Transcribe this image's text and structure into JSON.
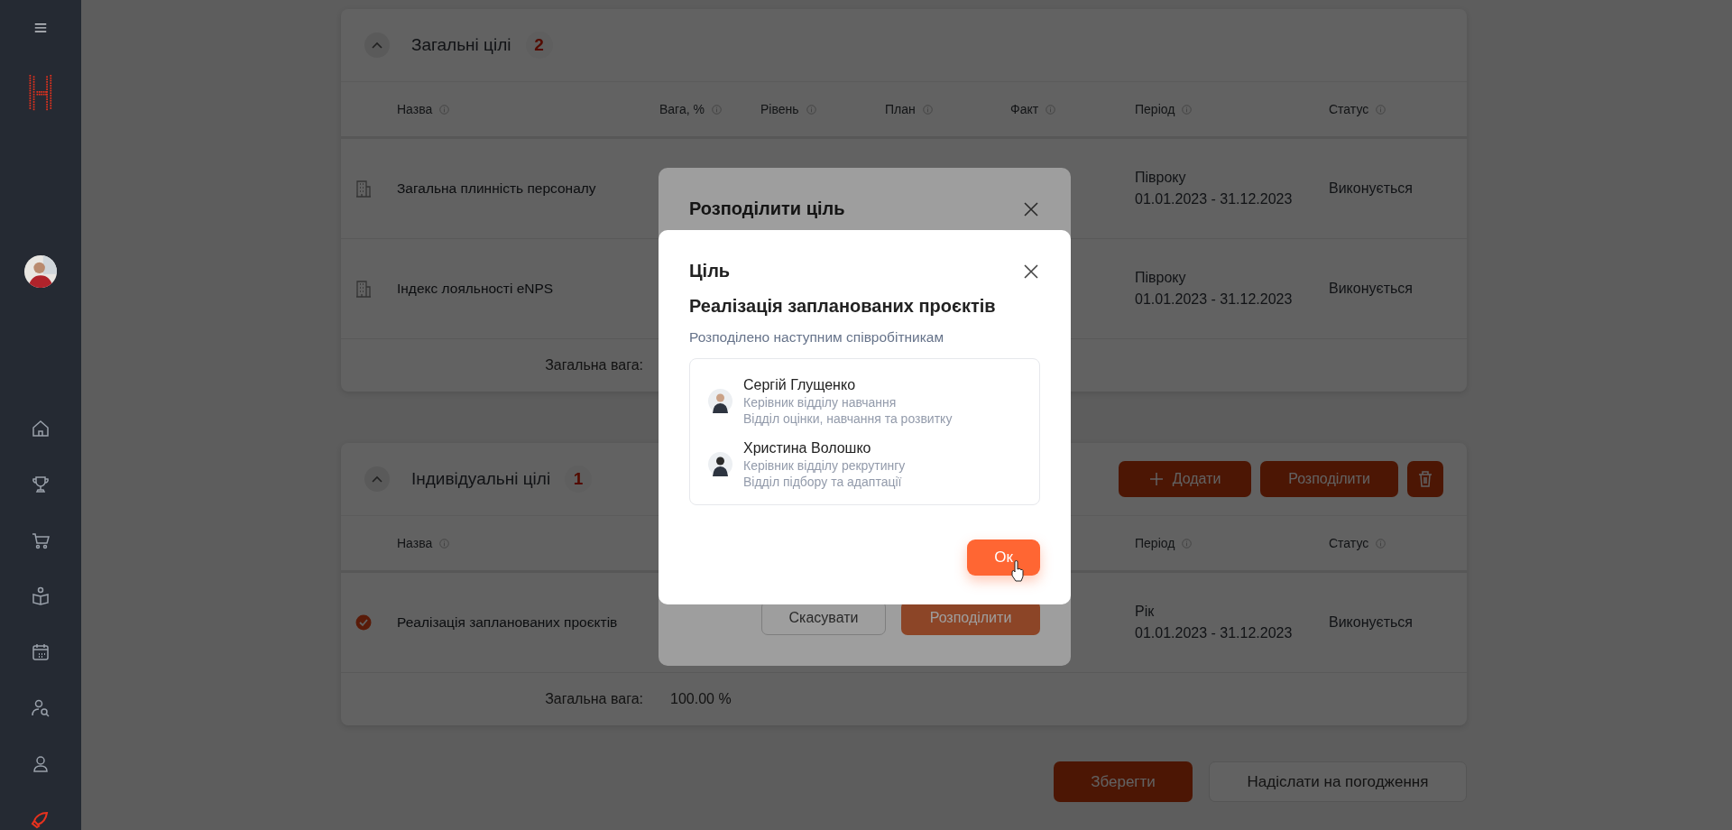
{
  "general_goals": {
    "title": "Загальні цілі",
    "count": "2",
    "expanded": true,
    "columns": [
      {
        "label": "Назва"
      },
      {
        "label": "Вага, %"
      },
      {
        "label": "Рівень"
      },
      {
        "label": "План"
      },
      {
        "label": "Факт"
      },
      {
        "label": "Період"
      },
      {
        "label": "Статус"
      }
    ],
    "rows": [
      {
        "name": "Загальна плинність персоналу",
        "period": "Півроку",
        "dates": "01.01.2023 - 31.12.2023",
        "status": "Виконується"
      },
      {
        "name": "Індекс лояльності eNPS",
        "period": "Півроку",
        "dates": "01.01.2023 - 31.12.2023",
        "status": "Виконується"
      }
    ],
    "total_label": "Загальна вага:"
  },
  "individual_goals": {
    "title": "Індивідуальні цілі",
    "count": "1",
    "expanded": true,
    "add": "Додати",
    "distribute": "Розподілити",
    "columns": [
      {
        "label": "Назва"
      },
      {
        "label": "Період"
      },
      {
        "label": "Статус"
      }
    ],
    "rows": [
      {
        "name": "Реалізація запланованих проєктів",
        "checked": true,
        "period": "Рік",
        "dates": "01.01.2023 - 31.12.2023",
        "status": "Виконується"
      }
    ],
    "total_label": "Загальна вага:",
    "total_value": "100.00 %"
  },
  "footer_buttons": [
    {
      "label": "Зберегти",
      "kind": "primary"
    },
    {
      "label": "Надіслати на погодження",
      "kind": "secondary"
    }
  ],
  "distribute_dialog": {
    "title": "Розподілити ціль",
    "buttons": [
      {
        "label": "Скасувати",
        "kind": "secondary",
        "disabled": false
      },
      {
        "label": "Розподілити",
        "kind": "primary",
        "disabled": true
      }
    ]
  },
  "goal_dialog": {
    "title": "Ціль",
    "goal": "Реалізація запланованих проєктів",
    "subtitle": "Розподілено наступним співробітникам",
    "employees": [
      {
        "name": "Сергій Глущенко",
        "position": "Керівник відділу навчання",
        "department": "Відділ оцінки, навчання та розвитку"
      },
      {
        "name": "Христина Волошко",
        "position": "Керівник відділу рекрутингу",
        "department": "Відділ підбору та адаптації"
      }
    ],
    "ok": "Ок"
  }
}
